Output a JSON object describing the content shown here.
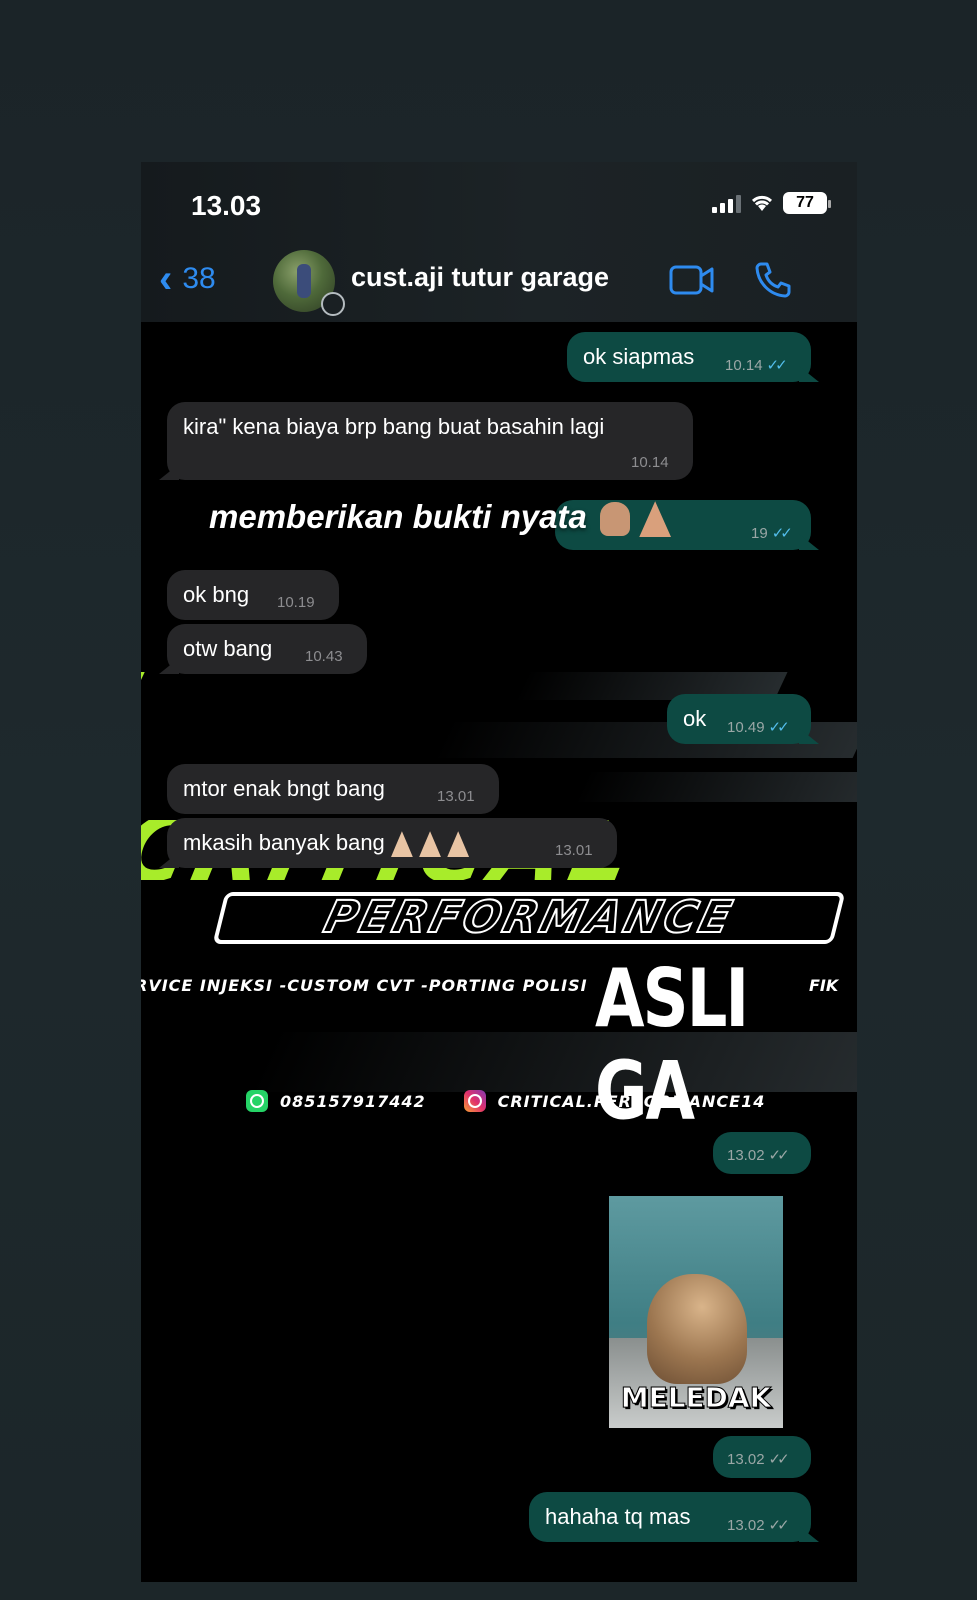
{
  "status_bar": {
    "time": "13.03",
    "battery": "77"
  },
  "header": {
    "back_count": "38",
    "contact_name": "cust.aji tutur garage"
  },
  "messages": [
    {
      "text": "ok siapmas",
      "time": "10.14"
    },
    {
      "text": "kira\" kena biaya brp bang buat basahin lagi",
      "time": "10.14"
    },
    {
      "text": "ok bng",
      "time": "10.19"
    },
    {
      "text": "otw bang",
      "time": "10.43"
    },
    {
      "text": "ok",
      "time": "10.49"
    },
    {
      "text": "mtor enak bngt bang",
      "time": "13.01"
    },
    {
      "text": "mkasih banyak bang",
      "time": "13.01"
    },
    {
      "text": "",
      "time": "13.02"
    },
    {
      "text": "",
      "time": "13.02"
    },
    {
      "text": "hahaha tq mas",
      "time": "13.02"
    }
  ],
  "overlay": {
    "caption": "memberikan bukti nyata",
    "hidden_time": "19"
  },
  "banner": {
    "brand": "CRITICAL",
    "subtitle": "PERFORMANCE",
    "services": "RVICE INJEKSI -CUSTOM CVT -PORTING POLISI",
    "services_tail": "FIK",
    "phone": "085157917442",
    "instagram": "CRITICAL.PERFORMANCE14"
  },
  "story_text": "ASLI GA",
  "sticker": {
    "caption": "MELEDAK"
  },
  "colors": {
    "outgoing": "#0d4a43",
    "incoming": "#262628",
    "accent": "#2e8bef",
    "banner_green": "#a8ec2a"
  }
}
